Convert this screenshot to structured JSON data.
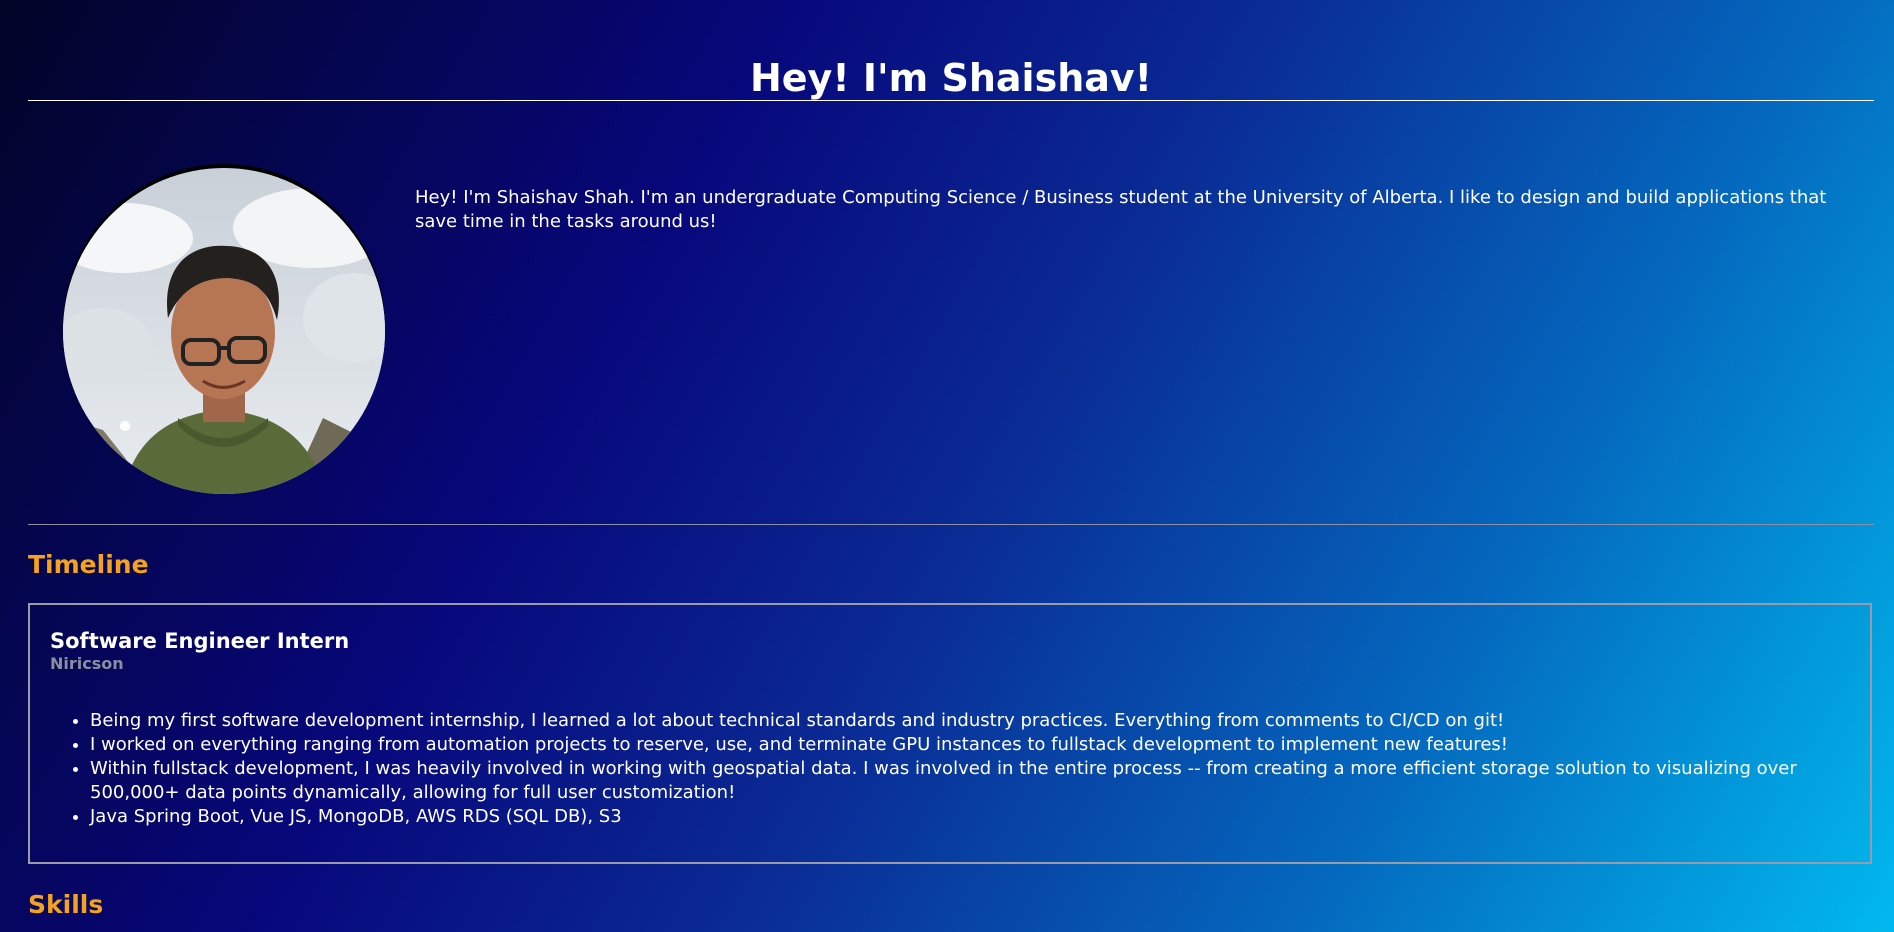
{
  "header": {
    "title": "Hey! I'm Shaishav!"
  },
  "about": {
    "photo_alt": "Portrait photo of Shaishav",
    "intro": "Hey! I'm Shaishav Shah. I'm an undergraduate Computing Science / Business student at the University of Alberta. I like to design and build applications that save time in the tasks around us!"
  },
  "timeline": {
    "heading": "Timeline",
    "entries": [
      {
        "title": "Software Engineer Intern",
        "company": "Niricson",
        "bullets": [
          "Being my first software development internship, I learned a lot about technical standards and industry practices. Everything from comments to CI/CD on git!",
          "I worked on everything ranging from automation projects to reserve, use, and terminate GPU instances to fullstack development to implement new features!",
          "Within fullstack development, I was heavily involved in working with geospatial data. I was involved in the entire process -- from creating a more efficient storage solution to visualizing over 500,000+ data points dynamically, allowing for full user customization!",
          "Java Spring Boot, Vue JS, MongoDB, AWS RDS (SQL DB), S3"
        ]
      }
    ]
  },
  "skills": {
    "heading": "Skills"
  },
  "colors": {
    "accent": "#f5a31a",
    "text": "#ffffff",
    "muted": "#8a8fa0",
    "gradient_start": "#020427",
    "gradient_end": "#01b9ee"
  }
}
